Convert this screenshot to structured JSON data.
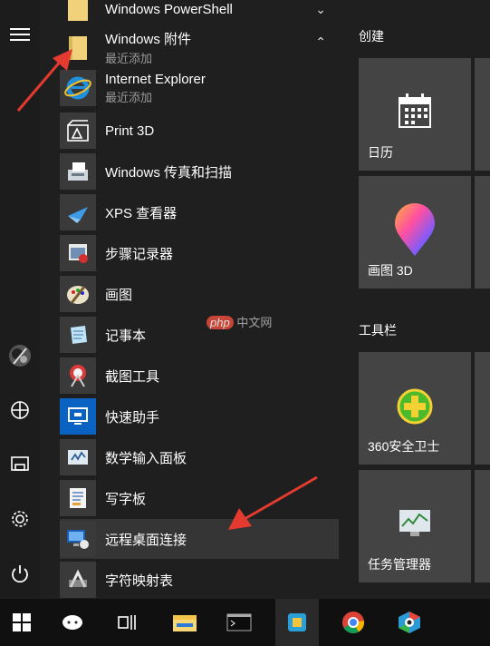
{
  "colors": {
    "accent": "#0078d7",
    "arrow": "#e53a2f",
    "tile": "#444444",
    "highlight": "#353535"
  },
  "rail": {
    "icons": [
      "menu-icon",
      "avatar",
      "documents-icon",
      "pictures-icon",
      "settings-icon",
      "power-icon"
    ]
  },
  "apps": {
    "powershell": {
      "name": "Windows PowerShell"
    },
    "accessories": {
      "name": "Windows 附件",
      "sub": "最近添加"
    },
    "ie": {
      "name": "Internet Explorer",
      "sub": "最近添加"
    },
    "print3d": {
      "name": "Print 3D"
    },
    "fax": {
      "name": "Windows 传真和扫描"
    },
    "xps": {
      "name": "XPS 查看器"
    },
    "steps": {
      "name": "步骤记录器"
    },
    "paint": {
      "name": "画图"
    },
    "notepad": {
      "name": "记事本"
    },
    "snip": {
      "name": "截图工具"
    },
    "quickassist": {
      "name": "快速助手"
    },
    "mathinput": {
      "name": "数学输入面板"
    },
    "wordpad": {
      "name": "写字板"
    },
    "rdp": {
      "name": "远程桌面连接"
    },
    "charmap": {
      "name": "字符映射表"
    }
  },
  "tiles": {
    "group1": "创建",
    "group2": "工具栏",
    "calendar": "日历",
    "paint3d": "画图 3D",
    "safe360": "360安全卫士",
    "taskmgr": "任务管理器"
  },
  "watermark": {
    "php": "php",
    "cn": "中文网"
  },
  "taskbar": {
    "icons": [
      "start-icon",
      "cortana-icon",
      "task-view-icon",
      "file-explorer-icon",
      "cmd-icon",
      "app-icon",
      "chrome-icon",
      "browser-icon"
    ]
  }
}
